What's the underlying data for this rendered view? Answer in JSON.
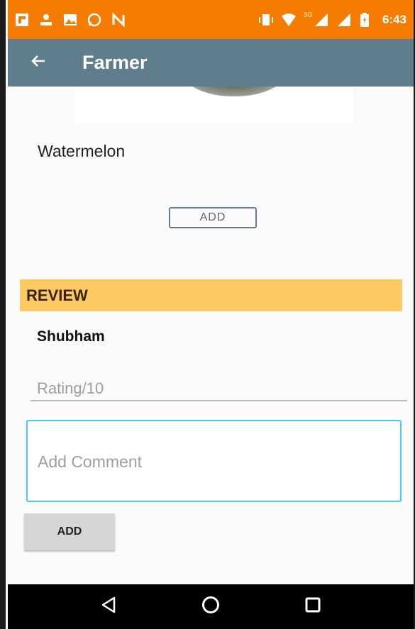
{
  "status_bar": {
    "time": "6:43",
    "network_label": "3G",
    "icons": [
      "flipboard-icon",
      "data-speed-icon",
      "gallery-icon",
      "whatsapp-icon",
      "n-app-icon",
      "vibrate-icon",
      "wifi-icon",
      "signal-icon",
      "signal-icon",
      "battery-icon"
    ]
  },
  "app_bar": {
    "title": "Farmer",
    "back_icon": "arrow-left-icon"
  },
  "product": {
    "name": "Watermelon",
    "add_label": "ADD"
  },
  "review": {
    "header": "REVIEW",
    "reviewer": "Shubham",
    "rating_placeholder": "Rating/10",
    "comment_placeholder": "Add Comment",
    "add_label": "ADD"
  },
  "nav_bar": {
    "icons": [
      "back-triangle-icon",
      "home-circle-icon",
      "recents-square-icon"
    ]
  },
  "colors": {
    "status_bar": "#f57c00",
    "app_bar": "#5f7d8c",
    "review_header": "#fdc963",
    "comment_border": "#4fc3f7"
  }
}
